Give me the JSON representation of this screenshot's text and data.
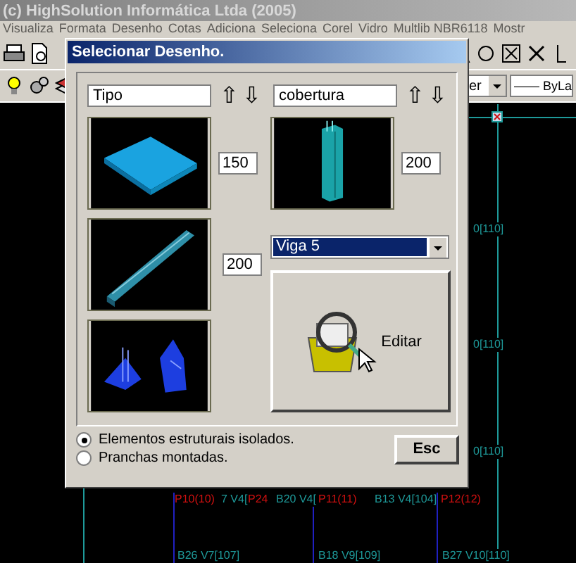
{
  "app": {
    "title": "(c) HighSolution Informática Ltda (2005)",
    "menu": [
      "Visualiza",
      "Formata",
      "Desenho",
      "Cotas",
      "Adiciona",
      "Seleciona",
      "Corel",
      "Vidro",
      "Multlib NBR6118",
      "Mostr"
    ],
    "layer_combo": "er",
    "linetype_combo": "—— ByLa"
  },
  "canvas_labels": [
    {
      "text": "0[110]",
      "color": "#1e9a9a"
    },
    {
      "text": "0[110]",
      "color": "#1e9a9a"
    },
    {
      "text": "0[110]",
      "color": "#1e9a9a"
    },
    {
      "text": "P10(10)",
      "color": "#d01010"
    },
    {
      "text": "7 V4[",
      "color": "#1e9a9a"
    },
    {
      "text": "P24",
      "color": "#d01010"
    },
    {
      "text": "B20 V4[",
      "color": "#1e9a9a"
    },
    {
      "text": "P11(11)",
      "color": "#d01010"
    },
    {
      "text": "B13 V4[104]",
      "color": "#1e9a9a"
    },
    {
      "text": "P12(12)",
      "color": "#d01010"
    },
    {
      "text": "B26 V7[107]",
      "color": "#1e9a9a"
    },
    {
      "text": "B18 V9[109]",
      "color": "#1e9a9a"
    },
    {
      "text": "B27 V10[110]",
      "color": "#1e9a9a"
    }
  ],
  "dialog": {
    "title": "Selecionar Desenho.",
    "left_field": "Tipo",
    "left_arrows": [
      "⇧",
      "⇩"
    ],
    "right_field": "cobertura",
    "right_arrows": [
      "⇧",
      "⇩"
    ],
    "previews": [
      {
        "kind": "slab",
        "value": "150"
      },
      {
        "kind": "column",
        "value": "200"
      },
      {
        "kind": "beam",
        "value": "200"
      },
      {
        "kind": "footing"
      }
    ],
    "dropdown": "Viga 5",
    "edit_button": "Editar",
    "radios": [
      {
        "label": "Elementos estruturais isolados.",
        "selected": true
      },
      {
        "label": "Pranchas montadas.",
        "selected": false
      }
    ],
    "esc_button": "Esc"
  }
}
